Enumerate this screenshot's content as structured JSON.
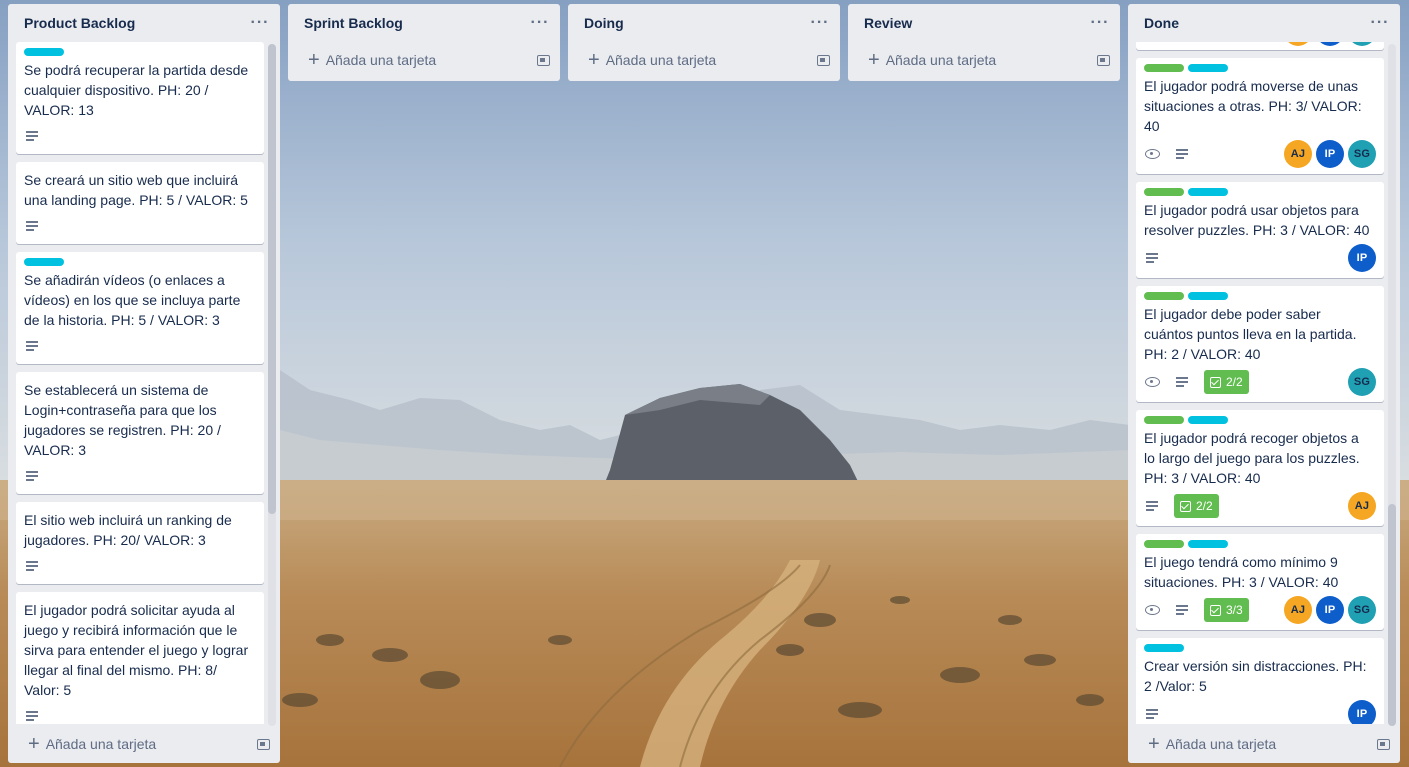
{
  "add_card_label": "Añada una tarjeta",
  "lists": [
    {
      "title": "Product Backlog",
      "cards": [
        {
          "labels": [
            "cyan"
          ],
          "title": "Se podrá recuperar la partida desde cualquier dispositivo. PH: 20 / VALOR: 13"
        },
        {
          "labels": [],
          "title": "Se creará un sitio web que incluirá una landing page. PH: 5 / VALOR: 5"
        },
        {
          "labels": [
            "cyan"
          ],
          "title": "Se añadirán vídeos (o enlaces a vídeos) en los que se incluya parte de la historia. PH: 5 / VALOR: 3"
        },
        {
          "labels": [],
          "title": "Se establecerá un sistema de Login+contraseña para que los jugadores se registren. PH: 20 / VALOR: 3"
        },
        {
          "labels": [],
          "title": "El sitio web incluirá un ranking de jugadores. PH: 20/ VALOR: 3"
        },
        {
          "labels": [],
          "title": "El jugador podrá solicitar ayuda al juego y recibirá información que le sirva para entender el juego y lograr llegar al final del mismo. PH: 8/ Valor: 5"
        }
      ]
    },
    {
      "title": "Sprint Backlog",
      "cards": []
    },
    {
      "title": "Doing",
      "cards": []
    },
    {
      "title": "Review",
      "cards": []
    },
    {
      "title": "Done",
      "cards": [
        {
          "labels": [
            "green",
            "cyan"
          ],
          "title": "El jugador podrá moverse de unas situaciones a otras. PH: 3/ VALOR: 40",
          "watch": true,
          "members": [
            "AJ",
            "IP",
            "SG"
          ]
        },
        {
          "labels": [
            "green",
            "cyan"
          ],
          "title": "El jugador podrá usar objetos para resolver puzzles. PH: 3 / VALOR: 40",
          "members": [
            "IP"
          ]
        },
        {
          "labels": [
            "green",
            "cyan"
          ],
          "title": "El jugador debe poder saber cuántos puntos lleva en la partida. PH: 2 / VALOR: 40",
          "watch": true,
          "checklist": "2/2",
          "members": [
            "SG"
          ]
        },
        {
          "labels": [
            "green",
            "cyan"
          ],
          "title": "El jugador podrá recoger objetos a lo largo del juego para los puzzles. PH: 3 / VALOR: 40",
          "checklist": "2/2",
          "members": [
            "AJ"
          ]
        },
        {
          "labels": [
            "green",
            "cyan"
          ],
          "title": "El juego tendrá como mínimo 9 situaciones. PH: 3 / VALOR: 40",
          "watch": true,
          "checklist": "3/3",
          "members": [
            "AJ",
            "IP",
            "SG"
          ]
        },
        {
          "labels": [
            "cyan"
          ],
          "title": "Crear versión sin distracciones. PH: 2 /Valor: 5",
          "members": [
            "IP"
          ]
        }
      ]
    }
  ],
  "colors": {
    "label_cyan": "#00c2e0",
    "label_green": "#61bd4f",
    "list_bg": "#ebecf0",
    "avatar_aj": "#f5a623",
    "avatar_ip": "#0d5dcb",
    "avatar_sg": "#1fa0b3"
  }
}
